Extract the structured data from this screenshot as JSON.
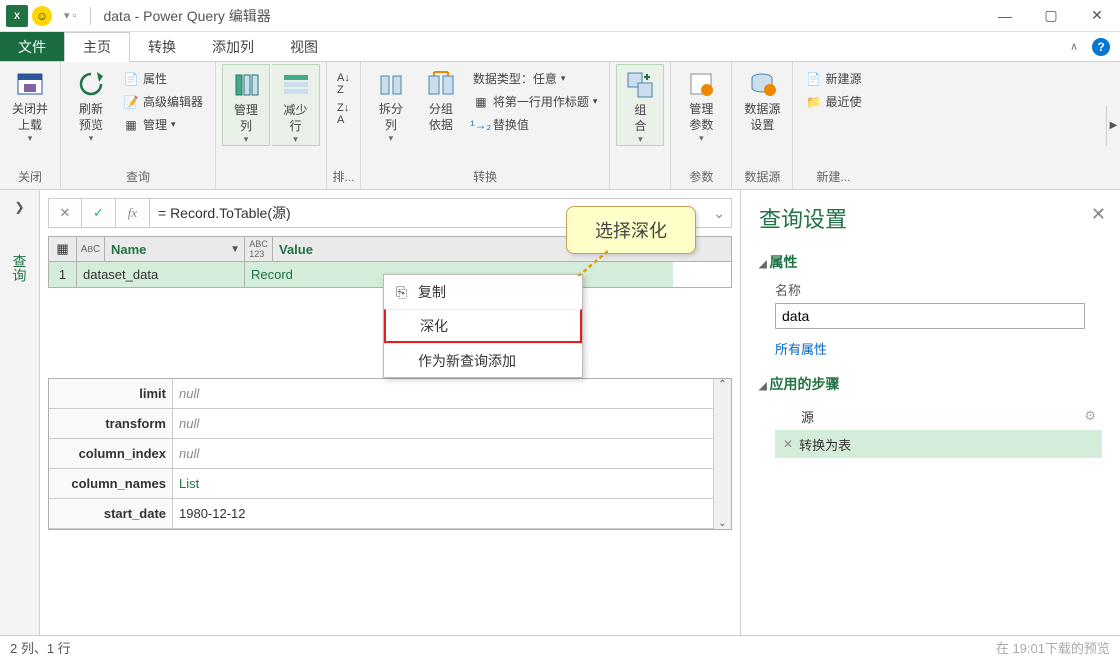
{
  "title": "data - Power Query 编辑器",
  "tabs": {
    "file": "文件",
    "home": "主页",
    "transform": "转换",
    "addcol": "添加列",
    "view": "视图"
  },
  "ribbon": {
    "close": {
      "btn": "关闭并\n上载",
      "label": "关闭"
    },
    "query": {
      "refresh": "刷新\n预览",
      "props": "属性",
      "adv": "高级编辑器",
      "manage": "管理",
      "label": "查询"
    },
    "cols": {
      "mcol": "管理\n列",
      "mrow": "减少\n行",
      "label": ""
    },
    "sort": {
      "label": "排..."
    },
    "split": {
      "btn": "拆分\n列",
      "group": "分组\n依据",
      "dtype": "数据类型：任意",
      "firstrow": "将第一行用作标题",
      "replace": "替换值",
      "label": "转换"
    },
    "combine": {
      "btn": "组\n合",
      "label": ""
    },
    "params": {
      "btn": "管理\n参数",
      "label": "参数"
    },
    "datasrc": {
      "btn": "数据源\n设置",
      "label": "数据源"
    },
    "newq": {
      "new": "新建源",
      "recent": "最近使",
      "label": "新建..."
    }
  },
  "nav": {
    "label": "查询"
  },
  "formula": "= Record.ToTable(源)",
  "table": {
    "cols": [
      "Name",
      "Value"
    ],
    "row": {
      "idx": "1",
      "name": "dataset_data",
      "value": "Record"
    }
  },
  "ctxmenu": {
    "copy": "复制",
    "drill": "深化",
    "addquery": "作为新查询添加"
  },
  "callout": "选择深化",
  "record": [
    {
      "k": "limit",
      "v": "null",
      "null": true
    },
    {
      "k": "transform",
      "v": "null",
      "null": true
    },
    {
      "k": "column_index",
      "v": "null",
      "null": true
    },
    {
      "k": "column_names",
      "v": "List",
      "null": false
    },
    {
      "k": "start_date",
      "v": "1980-12-12",
      "null": false
    }
  ],
  "settings": {
    "title": "查询设置",
    "props": "属性",
    "name_lbl": "名称",
    "name_val": "data",
    "allprops": "所有属性",
    "steps": "应用的步骤",
    "step1": "源",
    "step2": "转换为表"
  },
  "status": {
    "left": "2 列、1 行",
    "right": "在 19:01下载的预览"
  }
}
